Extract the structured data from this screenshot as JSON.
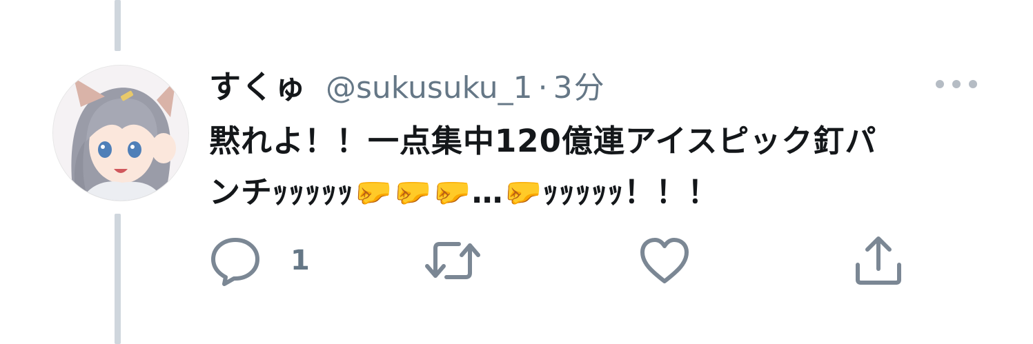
{
  "tweet": {
    "display_name": "すくゅ",
    "handle": "@sukusuku_1",
    "separator": "·",
    "time": "3分",
    "body_line1": "黙れよ！！一点集中120億連アイスピック釘パ",
    "body_line2": "ンチｯｯｯｯｯ🤛🤛🤛…🤛ｯｯｯｯｯ！！！",
    "reply_count": "1"
  },
  "icons": {
    "more": "more-dots-icon",
    "reply": "reply-icon",
    "retweet": "retweet-icon",
    "like": "heart-icon",
    "share": "share-icon"
  },
  "colors": {
    "text": "#14171a",
    "secondary": "#657786",
    "thread_line": "#cfd6dd",
    "icon": "#7b8794"
  }
}
